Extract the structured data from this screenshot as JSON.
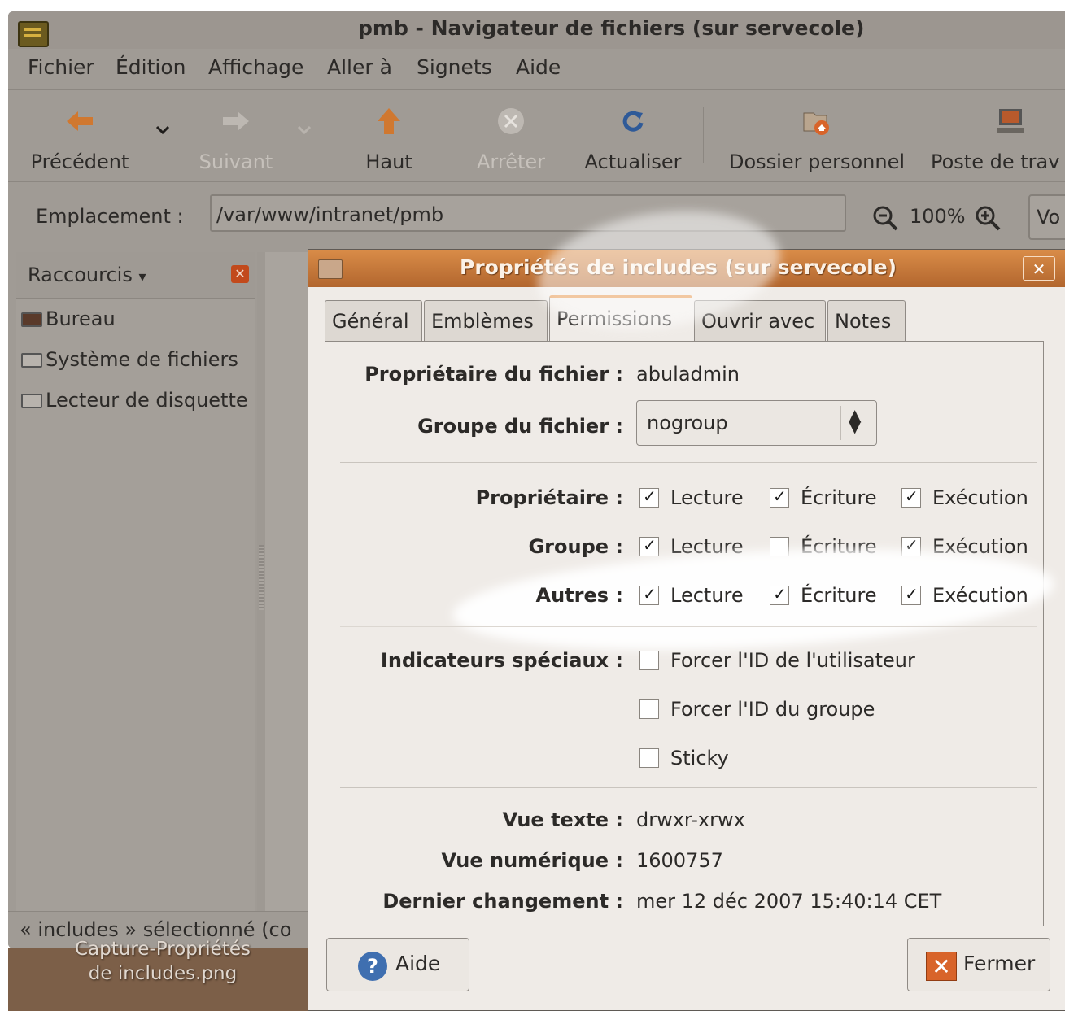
{
  "window": {
    "title": "pmb - Navigateur de fichiers (sur servecole)",
    "menu": [
      "Fichier",
      "Édition",
      "Affichage",
      "Aller à",
      "Signets",
      "Aide"
    ],
    "toolbar": {
      "back": "Précédent",
      "forward": "Suivant",
      "up": "Haut",
      "stop": "Arrêter",
      "reload": "Actualiser",
      "home": "Dossier personnel",
      "computer": "Poste de trav"
    },
    "location": {
      "label": "Emplacement :",
      "value": "/var/www/intranet/pmb",
      "zoom": "100%",
      "view_button": "Vo"
    },
    "sidebar": {
      "header": "Raccourcis",
      "items": [
        "Bureau",
        "Système de fichiers",
        "Lecteur de disquette"
      ]
    },
    "status": "« includes » sélectionné (co"
  },
  "desktop_icon_label": [
    "Capture-Propriétés",
    "de includes.png"
  ],
  "dialog": {
    "title": "Propriétés de includes (sur servecole)",
    "close_glyph": "✕",
    "tabs": [
      "Général",
      "Emblèmes",
      "Permissions",
      "Ouvrir avec",
      "Notes"
    ],
    "active_tab": "Permissions",
    "owner_label": "Propriétaire du fichier :",
    "owner_value": "abuladmin",
    "group_label": "Groupe du fichier :",
    "group_value": "nogroup",
    "perm_rows": [
      {
        "label": "Propriétaire :",
        "read": true,
        "write": true,
        "exec": true
      },
      {
        "label": "Groupe :",
        "read": true,
        "write": false,
        "exec": true
      },
      {
        "label": "Autres :",
        "read": true,
        "write": true,
        "exec": true
      }
    ],
    "perm_cols": {
      "read": "Lecture",
      "write": "Écriture",
      "exec": "Exécution"
    },
    "special_label": "Indicateurs spéciaux :",
    "special_flags": [
      {
        "label": "Forcer l'ID de l'utilisateur",
        "checked": false
      },
      {
        "label": "Forcer l'ID du groupe",
        "checked": false
      },
      {
        "label": "Sticky",
        "checked": false
      }
    ],
    "text_view_label": "Vue texte :",
    "text_view_value": "drwxr-xrwx",
    "numeric_label": "Vue numérique :",
    "numeric_value": "1600757",
    "changed_label": "Dernier changement :",
    "changed_value": "mer 12 déc 2007 15:40:14 CET",
    "help_button": "Aide",
    "close_button": "Fermer"
  }
}
